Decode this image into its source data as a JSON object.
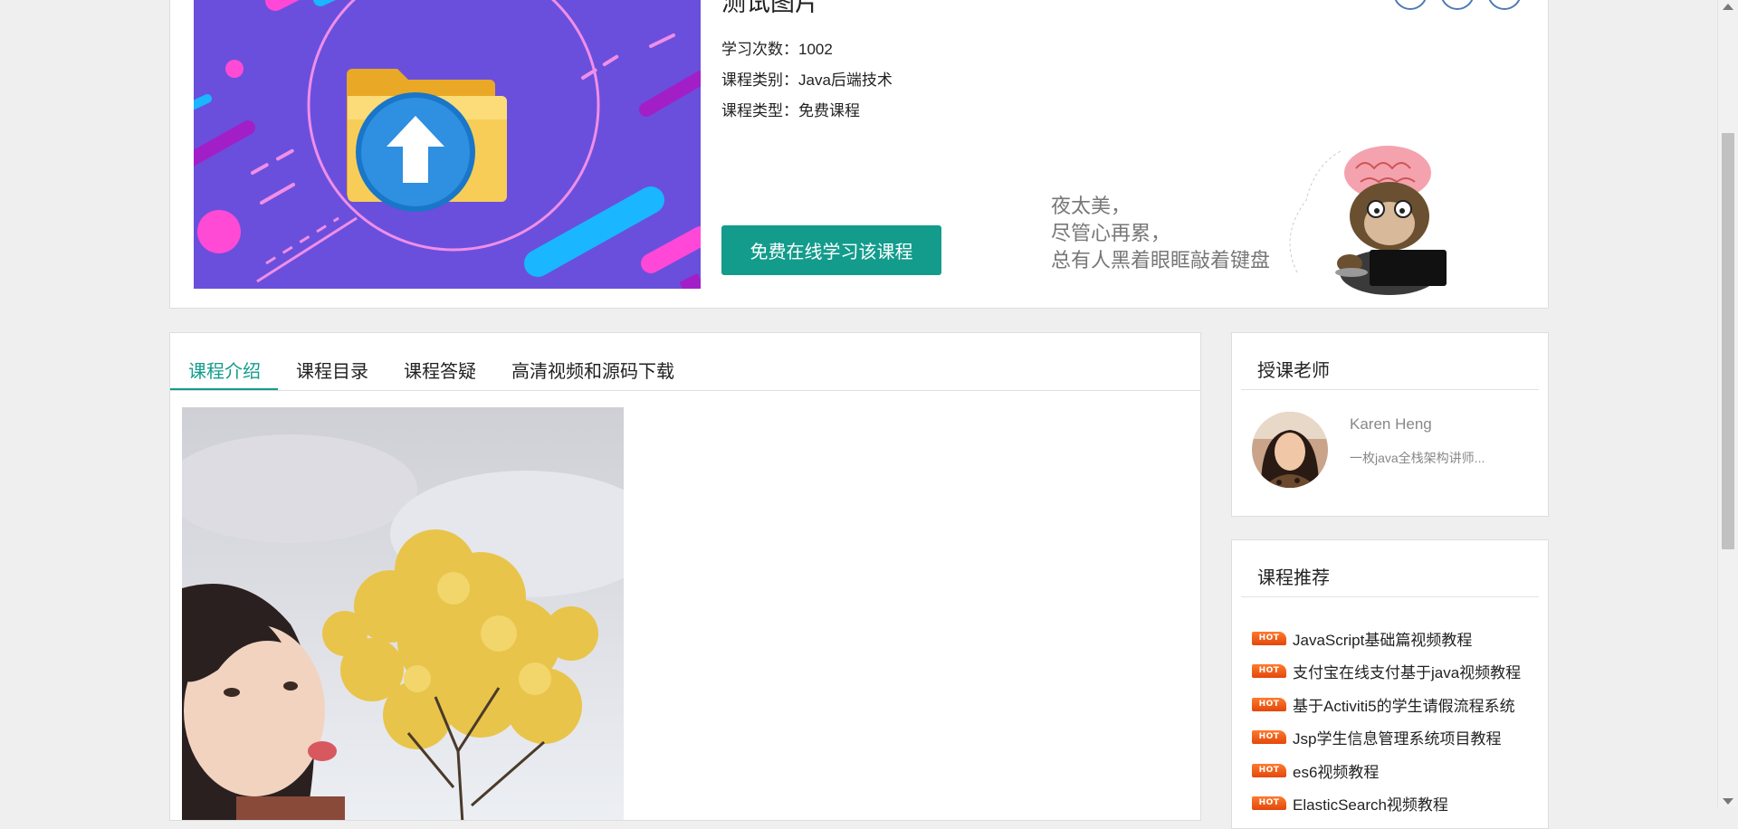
{
  "course": {
    "title": "测试图片",
    "stats": [
      {
        "label": "学习次数：",
        "value": "1002"
      },
      {
        "label": "课程类别：",
        "value": "Java后端技术"
      },
      {
        "label": "课程类型：",
        "value": "免费课程"
      }
    ],
    "cta_label": "免费在线学习该课程",
    "slogan": "夜太美，\n尽管心再累，\n总有人黑着眼眶敲着键盘"
  },
  "tabs": [
    {
      "label": "课程介绍",
      "active": true
    },
    {
      "label": "课程目录",
      "active": false
    },
    {
      "label": "课程答疑",
      "active": false
    },
    {
      "label": "高清视频和源码下载",
      "active": false
    }
  ],
  "teacher": {
    "heading": "授课老师",
    "name": "Karen Heng",
    "desc": "一枚java全栈架构讲师..."
  },
  "recommend": {
    "heading": "课程推荐",
    "badge": "HOT",
    "items": [
      "JavaScript基础篇视频教程",
      "支付宝在线支付基于java视频教程",
      "基于Activiti5的学生请假流程系统",
      "Jsp学生信息管理系统项目教程",
      "es6视频教程",
      "ElasticSearch视频教程"
    ]
  },
  "colors": {
    "accent": "#139c8c",
    "hot_badge": "#f06420",
    "share_icon": "#4d7ab6"
  },
  "icons": [
    "facebook-icon",
    "twitter-icon",
    "linkedin-icon",
    "hot-badge-icon",
    "folder-upload-icon"
  ]
}
